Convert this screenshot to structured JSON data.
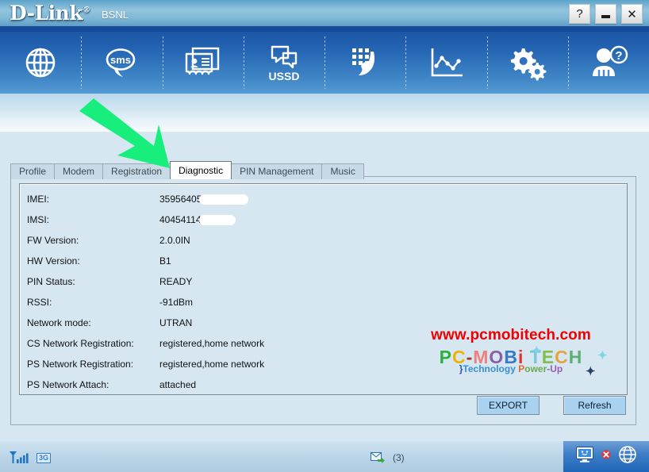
{
  "window": {
    "brand": "D-Link",
    "trademark": "®",
    "buttons": {
      "help": "?",
      "minimize": "_",
      "close": "✕"
    }
  },
  "toolbar": {
    "items": [
      {
        "icon": "globe-icon",
        "label": "Internet"
      },
      {
        "icon": "sms-icon",
        "label": "sms"
      },
      {
        "icon": "contacts-icon",
        "label": "Contacts"
      },
      {
        "icon": "ussd-icon",
        "label": "USSD"
      },
      {
        "icon": "dialpad-phone-icon",
        "label": "Call"
      },
      {
        "icon": "statistics-chart-icon",
        "label": "Statistics"
      },
      {
        "icon": "settings-gears-icon",
        "label": "Settings"
      },
      {
        "icon": "user-help-icon",
        "label": "Help"
      }
    ]
  },
  "tabs": [
    {
      "label": "Profile",
      "active": false
    },
    {
      "label": "Modem",
      "active": false
    },
    {
      "label": "Registration",
      "active": false
    },
    {
      "label": "Diagnostic",
      "active": true
    },
    {
      "label": "PIN Management",
      "active": false
    },
    {
      "label": "Music",
      "active": false
    }
  ],
  "diagnostic": {
    "rows": [
      {
        "label": "IMEI:",
        "value": "35956405",
        "redacted": true,
        "redact_width": 62
      },
      {
        "label": "IMSI:",
        "value": "40454114",
        "redacted": true,
        "redact_width": 46
      },
      {
        "label": "FW Version:",
        "value": "2.0.0IN",
        "redacted": false
      },
      {
        "label": "HW Version:",
        "value": "B1",
        "redacted": false
      },
      {
        "label": "PIN Status:",
        "value": "READY",
        "redacted": false
      },
      {
        "label": "RSSI:",
        "value": "-91dBm",
        "redacted": false
      },
      {
        "label": "Network mode:",
        "value": "UTRAN",
        "redacted": false
      },
      {
        "label": "CS Network Registration:",
        "value": "registered,home network",
        "redacted": false
      },
      {
        "label": "PS Network Registration:",
        "value": "registered,home network",
        "redacted": false
      },
      {
        "label": "PS Network Attach:",
        "value": "attached",
        "redacted": false
      }
    ],
    "export_label": "EXPORT",
    "refresh_label": "Refresh"
  },
  "watermark": {
    "url": "www.pcmobitech.com",
    "logo_main": "PC-MOBI TECH",
    "tagline": "}Technology Power-Up"
  },
  "statusbar": {
    "signal_icon": "signal-bars-icon",
    "network_badge": "3G",
    "carrier": "BSNL",
    "message_icon": "envelope-icon",
    "message_count": "(3)",
    "tray_icons": [
      "monitor-icon",
      "disconnect-icon",
      "globe-icon"
    ]
  },
  "annotation": {
    "arrow_color": "#18EE7C",
    "points_at": "Diagnostic"
  },
  "colors": {
    "title_blue": "#17499a",
    "toolbar_blue": "#2464b3",
    "workspace": "#d6e7f1",
    "button_blue": "#a8d2f0",
    "watermark_red": "#f00000"
  }
}
